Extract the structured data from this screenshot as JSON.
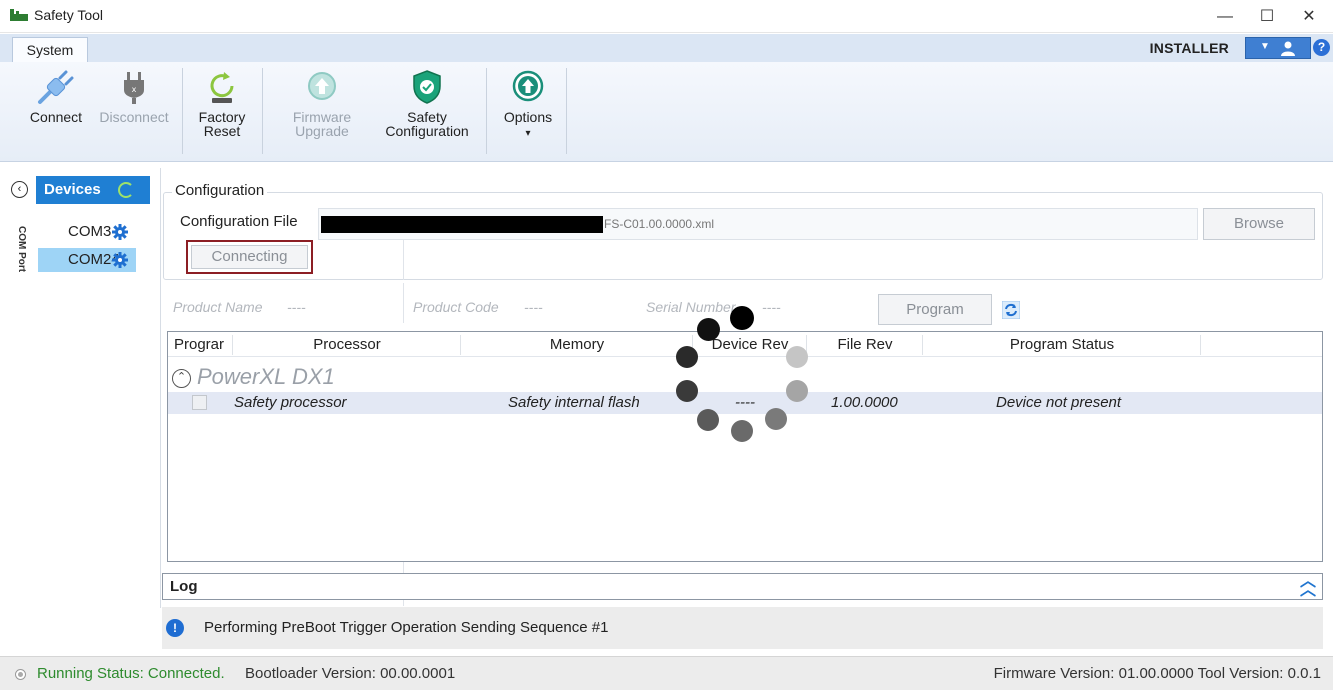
{
  "window": {
    "title": "Safety Tool",
    "minimize": "—",
    "maximize": "☐",
    "close": "✕"
  },
  "ribbon_tab": {
    "system": "System"
  },
  "user": {
    "role": "INSTALLER",
    "help": "?"
  },
  "ribbon": {
    "connect": "Connect",
    "disconnect": "Disconnect",
    "factory_reset_1": "Factory",
    "factory_reset_2": "Reset",
    "firmware_upgrade_1": "Firmware",
    "firmware_upgrade_2": "Upgrade",
    "safety_config_1": "Safety",
    "safety_config_2": "Configuration",
    "options": "Options",
    "options_arrow": "▾"
  },
  "devices": {
    "header": "Devices",
    "group_label": "COM Port",
    "items": [
      {
        "label": "COM3",
        "selected": false
      },
      {
        "label": "COM24",
        "selected": true
      }
    ]
  },
  "configuration": {
    "legend": "Configuration",
    "file_label": "Configuration File",
    "file_value_visible": "FS-C01.00.0000.xml",
    "browse": "Browse",
    "connecting": "Connecting"
  },
  "product": {
    "name_label": "Product Name",
    "name_value": "----",
    "code_label": "Product Code",
    "code_value": "----",
    "serial_label": "Serial Number",
    "serial_value": "----",
    "program": "Program"
  },
  "grid": {
    "columns": [
      "Prograr",
      "Processor",
      "Memory",
      "Device Rev",
      "File Rev",
      "Program Status"
    ],
    "group": "PowerXL DX1",
    "rows": [
      {
        "processor": "Safety processor",
        "memory": "Safety internal flash",
        "device_rev": "----",
        "file_rev": "1.00.0000",
        "status": "Device not present"
      }
    ]
  },
  "log": {
    "title": "Log",
    "message": "Performing PreBoot Trigger Operation Sending Sequence #1"
  },
  "status": {
    "running": "Running Status: Connected.",
    "bootloader": "Bootloader Version: 00.00.0001",
    "versions": "Firmware Version: 01.00.0000 Tool Version: 0.0.1"
  },
  "colors": {
    "accent": "#1f7fd3",
    "selected": "#9ed4f6",
    "status_ok": "#2e8b2e",
    "highlight_border": "#8c1e24"
  }
}
